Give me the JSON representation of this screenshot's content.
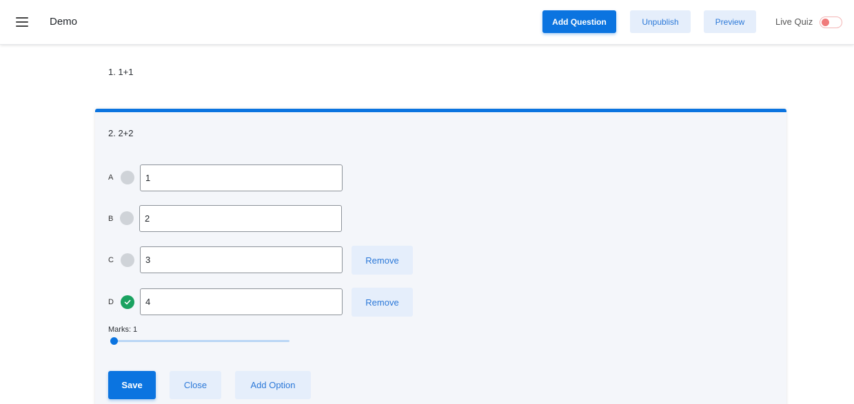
{
  "header": {
    "title": "Demo",
    "menu_icon": "hamburger-menu-icon",
    "add_question_label": "Add Question",
    "unpublish_label": "Unpublish",
    "preview_label": "Preview",
    "live_quiz_label": "Live Quiz",
    "live_quiz_on": false
  },
  "questions": [
    {
      "number": "1.",
      "text": "1+1",
      "label": "1.  1+1"
    },
    {
      "number": "2.",
      "text": "2+2",
      "label": "2.  2+2"
    }
  ],
  "editor": {
    "options": [
      {
        "letter": "A",
        "value": "1",
        "correct": false
      },
      {
        "letter": "B",
        "value": "2",
        "correct": false
      },
      {
        "letter": "C",
        "value": "3",
        "correct": false,
        "remove_label": "Remove"
      },
      {
        "letter": "D",
        "value": "4",
        "correct": true,
        "remove_label": "Remove"
      }
    ],
    "marks_label": "Marks: 1",
    "marks_value": 1,
    "save_label": "Save",
    "close_label": "Close",
    "add_option_label": "Add Option"
  },
  "colors": {
    "accent": "#0b74e0",
    "soft_button": "#e5eefb",
    "correct": "#1aa260",
    "toggle_off": "#f07b7b"
  }
}
